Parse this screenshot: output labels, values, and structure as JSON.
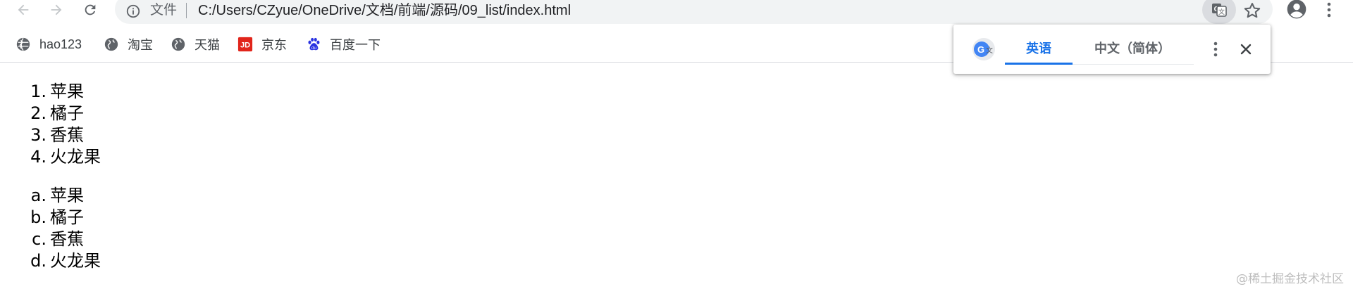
{
  "browser": {
    "url_scheme_label": "文件",
    "url": "C:/Users/CZyue/OneDrive/文档/前端/源码/09_list/index.html",
    "icons": {
      "back": "arrow-left-icon",
      "forward": "arrow-right-icon",
      "reload": "reload-icon",
      "info": "info-icon",
      "translate": "translate-icon",
      "bookmark": "star-icon",
      "profile": "account-icon",
      "menu": "kebab-menu-icon"
    }
  },
  "bookmarks": [
    {
      "label": "hao123",
      "icon": "globe-icon"
    },
    {
      "label": "淘宝",
      "icon": "globe-icon"
    },
    {
      "label": "天猫",
      "icon": "globe-icon"
    },
    {
      "label": "京东",
      "icon": "jd-logo-icon"
    },
    {
      "label": "百度一下",
      "icon": "baidu-paw-icon"
    }
  ],
  "translate_bubble": {
    "source_language": "英语",
    "target_language": "中文（简体）",
    "accent_color": "#1a73e8"
  },
  "ordered_list": {
    "type": "1",
    "items": [
      {
        "marker": "1.",
        "text": "苹果"
      },
      {
        "marker": "2.",
        "text": "橘子"
      },
      {
        "marker": "3.",
        "text": "香蕉"
      },
      {
        "marker": "4.",
        "text": "火龙果"
      }
    ]
  },
  "lettered_list": {
    "type": "a",
    "items": [
      {
        "marker": "a.",
        "text": "苹果"
      },
      {
        "marker": "b.",
        "text": "橘子"
      },
      {
        "marker": "c.",
        "text": "香蕉"
      },
      {
        "marker": "d.",
        "text": "火龙果"
      }
    ]
  },
  "watermark": "@稀土掘金技术社区"
}
